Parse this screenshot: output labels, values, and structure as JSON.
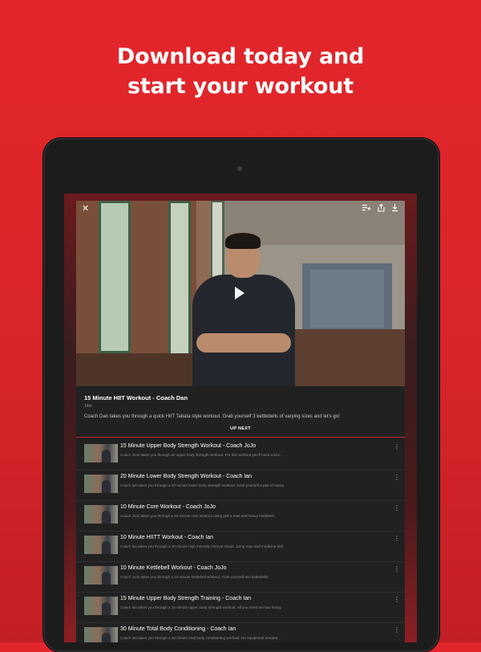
{
  "headline": {
    "line1": "Download today and",
    "line2": "start your workout"
  },
  "player": {
    "icons": {
      "close": "close-icon",
      "add_to_playlist": "add-to-playlist-icon",
      "share": "share-icon",
      "download": "download-icon",
      "play": "play-icon"
    },
    "title": "15 Minute HIIT Workout - Coach Dan",
    "duration": "14m",
    "description": "Coach Dan takes you through a quick HIIT Tabata style workout. Grab yourself 3 kettlebells of varying sizes and let's go!"
  },
  "up_next": {
    "label": "UP NEXT",
    "items": [
      {
        "title": "15 Minute Upper Body Strength Workout - Coach JoJo",
        "description": "Coach JoJo takes you through an upper body strength workout. For this workout you'll need a box..."
      },
      {
        "title": "20 Minute Lower Body Strength Workout - Coach Ian",
        "description": "Coach Ian takes you through a 20 minute lower body strength workout. Grab yourself a pair of heavy."
      },
      {
        "title": "10 Minute Core Workout - Coach JoJo",
        "description": "Coach JoJo takes you through a 10 minute core workout using just a matt and heavy kettlebell."
      },
      {
        "title": "10 Minute HIITT Workout - Coach Ian",
        "description": "Coach Ian takes you through a 10 minute high intensity interval circuit. Jump rope and medicine ball"
      },
      {
        "title": "10 Minute Kettlebell Workout - Coach JoJo",
        "description": "Coach JoJo takes you through a 10 minute kettlebell workout. Grab yourself two kettlebells"
      },
      {
        "title": "15 Minute Upper Body Strength Training - Coach Ian",
        "description": "Coach Ian takes you through a 15 minute upper body strength workout. All you need are two heavy"
      },
      {
        "title": "30 Minute Total Body Conditioning - Coach Ian",
        "description": "Coach Ian takes you through a 30 minute total body conditioning workout. No equipment needed..."
      }
    ]
  },
  "colors": {
    "brand_red": "#e2262b",
    "accent_line": "#c3272d",
    "panel_bg": "#212121"
  }
}
